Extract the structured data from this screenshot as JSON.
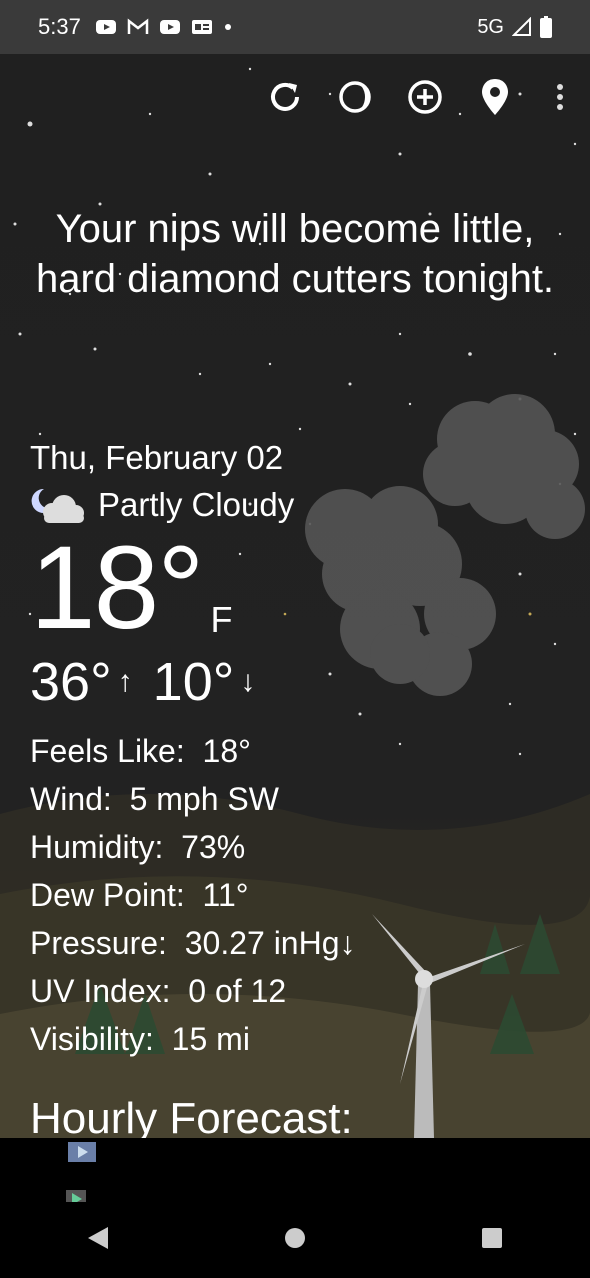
{
  "status_bar": {
    "time": "5:37",
    "network": "5G",
    "icons": [
      "youtube-icon",
      "gmail-icon",
      "youtube-icon",
      "news-icon",
      "dot-icon",
      "signal-icon",
      "battery-icon"
    ]
  },
  "toolbar": {
    "icons": [
      "refresh-icon",
      "theme-icon",
      "add-location-icon",
      "location-pin-icon",
      "more-vert-icon"
    ]
  },
  "tagline": "Your nips will become little, hard diamond cutters tonight.",
  "weather": {
    "date": "Thu, February 02",
    "condition": "Partly Cloudy",
    "temperature": "18°",
    "unit": "F",
    "high": "36°",
    "low": "10°",
    "details": [
      {
        "label": "Feels Like:",
        "value": "18°"
      },
      {
        "label": "Wind:",
        "value": "5 mph SW"
      },
      {
        "label": "Humidity:",
        "value": "73%"
      },
      {
        "label": "Dew Point:",
        "value": "11°"
      },
      {
        "label": "Pressure:",
        "value": "30.27 inHg↓"
      },
      {
        "label": "UV Index:",
        "value": "0 of 12"
      },
      {
        "label": "Visibility:",
        "value": "15 mi"
      }
    ]
  },
  "hourly_title": "Hourly Forecast:",
  "colors": {
    "sky": "#202020",
    "cloud": "#555555",
    "status_bar": "#3a3a3a"
  }
}
